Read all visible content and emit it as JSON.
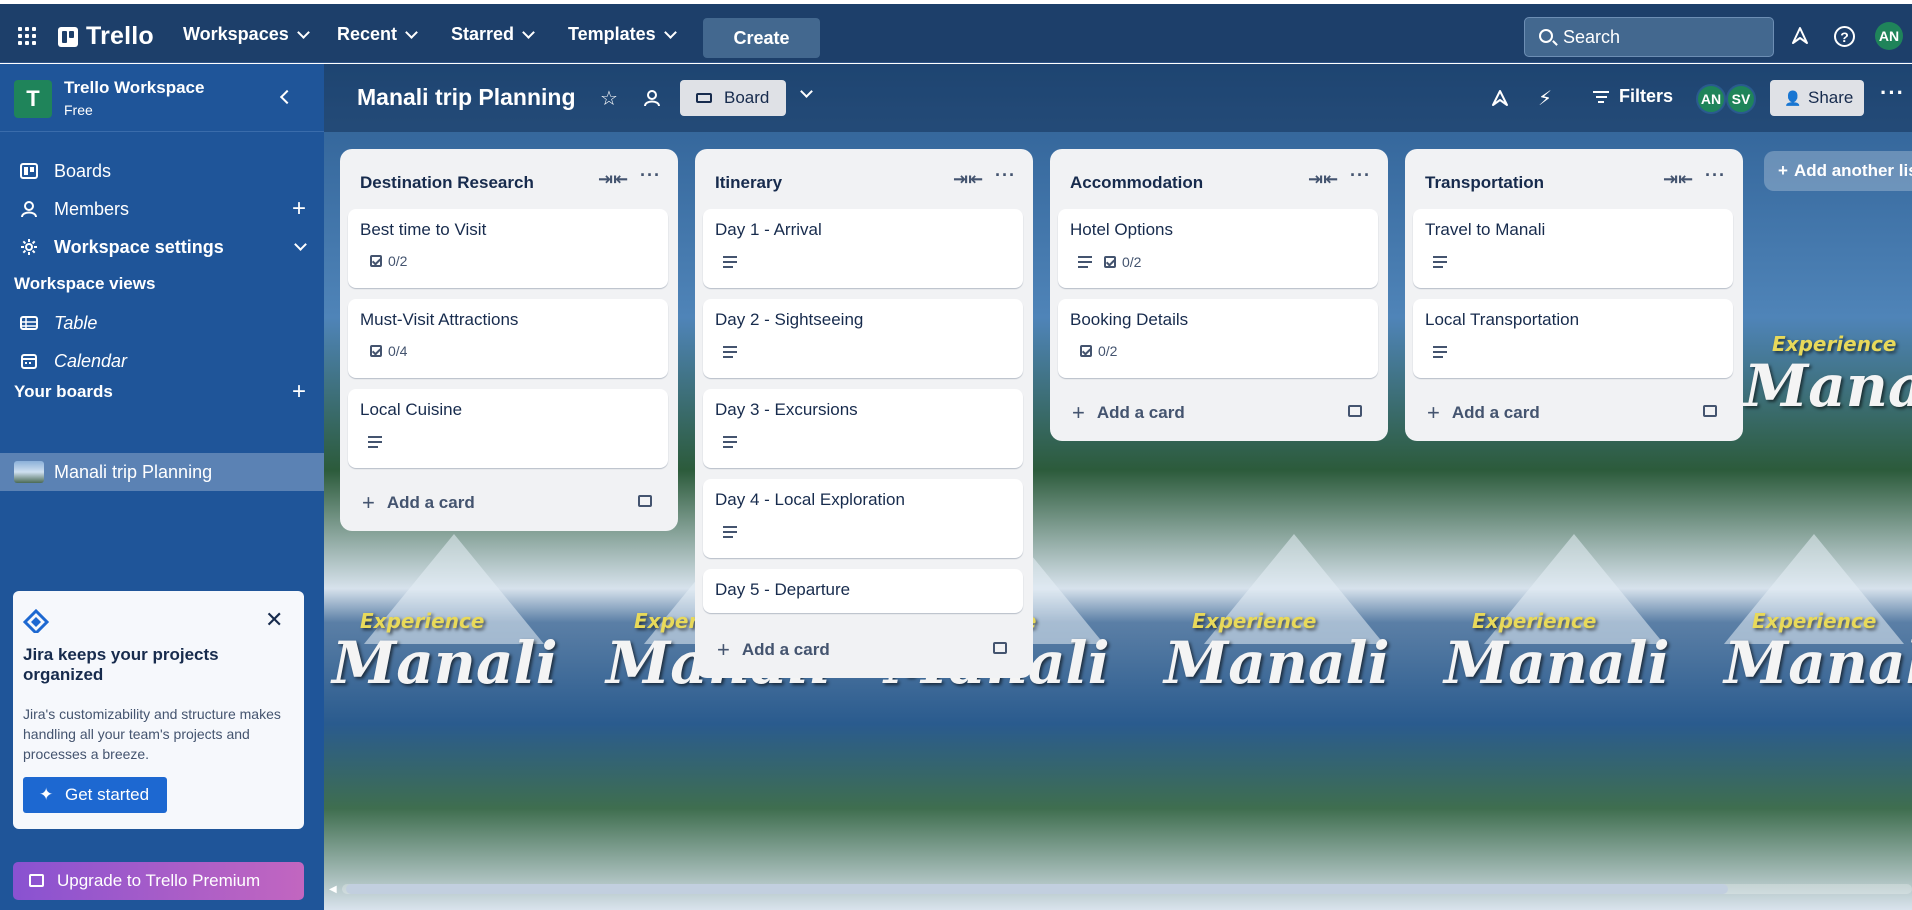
{
  "topbar": {
    "logo": "Trello",
    "menus": [
      "Workspaces",
      "Recent",
      "Starred",
      "Templates"
    ],
    "create_label": "Create",
    "search_placeholder": "Search",
    "help": "?",
    "avatar": "AN"
  },
  "sidebar": {
    "workspace_initial": "T",
    "workspace_name": "Trello Workspace",
    "workspace_plan": "Free",
    "items": [
      {
        "label": "Boards",
        "icon": "board-icon"
      },
      {
        "label": "Members",
        "icon": "person-icon"
      },
      {
        "label": "Workspace settings",
        "icon": "gear-icon"
      }
    ],
    "views_heading": "Workspace views",
    "views": [
      {
        "label": "Table",
        "icon": "table-icon"
      },
      {
        "label": "Calendar",
        "icon": "calendar-icon"
      }
    ],
    "boards_heading": "Your boards",
    "boards": [
      "Manali trip Planning"
    ],
    "promo": {
      "title": "Jira keeps your projects organized",
      "body": "Jira's customizability and structure makes handling all your team's projects and processes a breeze.",
      "cta": "Get started"
    },
    "upgrade": "Upgrade to Trello Premium"
  },
  "board": {
    "title": "Manali trip Planning",
    "view_label": "Board",
    "filters_label": "Filters",
    "members": [
      "AN",
      "SV"
    ],
    "share_label": "Share",
    "add_list_label": "Add another list",
    "add_card_label": "Add a card",
    "background_text": {
      "experience": "Experience",
      "manali": "Manali"
    },
    "lists": [
      {
        "title": "Destination Research",
        "cards": [
          {
            "title": "Best time to Visit",
            "desc": false,
            "checklist": "0/2"
          },
          {
            "title": "Must-Visit Attractions",
            "desc": false,
            "checklist": "0/4"
          },
          {
            "title": "Local Cuisine",
            "desc": true,
            "checklist": null
          }
        ]
      },
      {
        "title": "Itinerary",
        "cards": [
          {
            "title": "Day 1 - Arrival",
            "desc": true,
            "checklist": null
          },
          {
            "title": "Day 2 - Sightseeing",
            "desc": true,
            "checklist": null
          },
          {
            "title": "Day 3 - Excursions",
            "desc": true,
            "checklist": null
          },
          {
            "title": "Day 4 - Local Exploration",
            "desc": true,
            "checklist": null
          },
          {
            "title": "Day 5 - Departure",
            "desc": false,
            "checklist": null
          }
        ]
      },
      {
        "title": "Accommodation",
        "cards": [
          {
            "title": "Hotel Options",
            "desc": true,
            "checklist": "0/2"
          },
          {
            "title": "Booking Details",
            "desc": false,
            "checklist": "0/2"
          }
        ]
      },
      {
        "title": "Transportation",
        "cards": [
          {
            "title": "Travel to Manali",
            "desc": true,
            "checklist": null
          },
          {
            "title": "Local Transportation",
            "desc": true,
            "checklist": null
          }
        ]
      }
    ]
  },
  "colors": {
    "topbar": "#1d3f6a",
    "sidebar": "#1f5599",
    "accent_green": "#1f845a",
    "list_bg": "#f1f2f4"
  }
}
